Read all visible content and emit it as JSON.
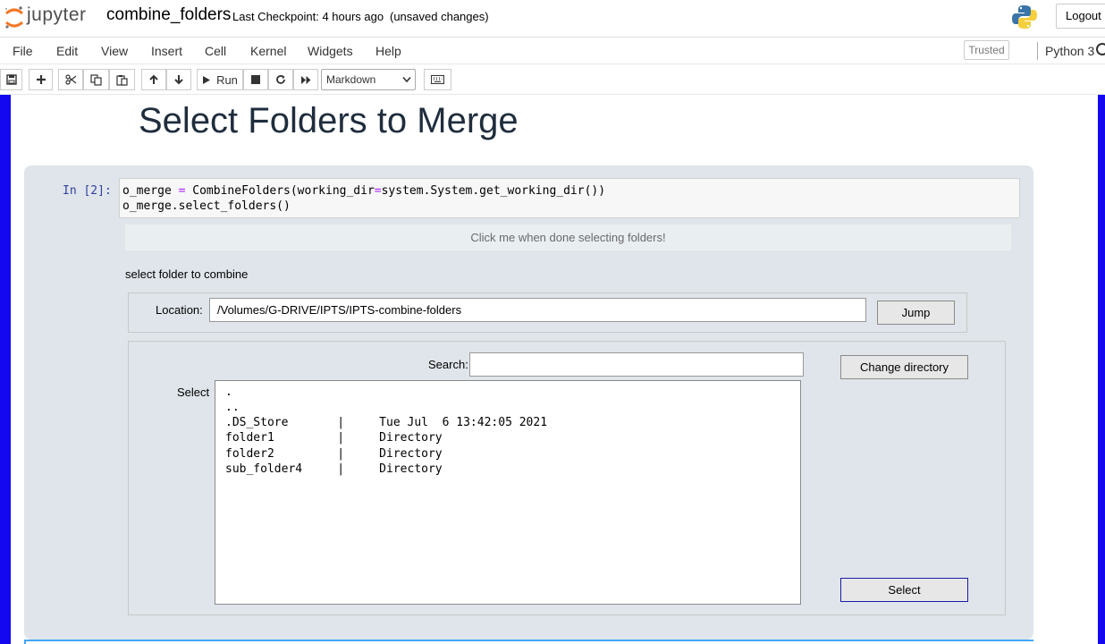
{
  "header": {
    "logo_text": "jupyter",
    "notebook_name": "combine_folders",
    "checkpoint": "Last Checkpoint: 4 hours ago",
    "save_status": "(unsaved changes)",
    "logout_label": "Logout"
  },
  "menu": {
    "items": [
      "File",
      "Edit",
      "View",
      "Insert",
      "Cell",
      "Kernel",
      "Widgets",
      "Help"
    ],
    "trusted": "Trusted",
    "kernel_name": "Python 3"
  },
  "toolbar": {
    "run_label": "Run",
    "cell_type": "Markdown"
  },
  "notebook": {
    "heading": "Select Folders to Merge",
    "cell": {
      "prompt": "In [2]:",
      "code_line1_a": "o_merge ",
      "code_line1_op": "=",
      "code_line1_b": " CombineFolders(working_dir",
      "code_line1_op2": "=",
      "code_line1_c": "system.System.get_working_dir())",
      "code_line2": "o_merge.select_folders()"
    },
    "widget": {
      "done_button": "Click me when done selecting folders!",
      "instruction": "select folder to combine",
      "location_label": "Location:",
      "location_value": "/Volumes/G-DRIVE/IPTS/IPTS-combine-folders",
      "jump_button": "Jump",
      "search_label": "Search:",
      "search_value": "",
      "change_dir_button": "Change directory",
      "select_label": "Select",
      "select_button": "Select",
      "entries": [
        ".",
        "..",
        ".DS_Store       |     Tue Jul  6 13:42:05 2021",
        "folder1         |     Directory",
        "folder2         |     Directory",
        "sub_folder4     |     Directory"
      ]
    }
  }
}
